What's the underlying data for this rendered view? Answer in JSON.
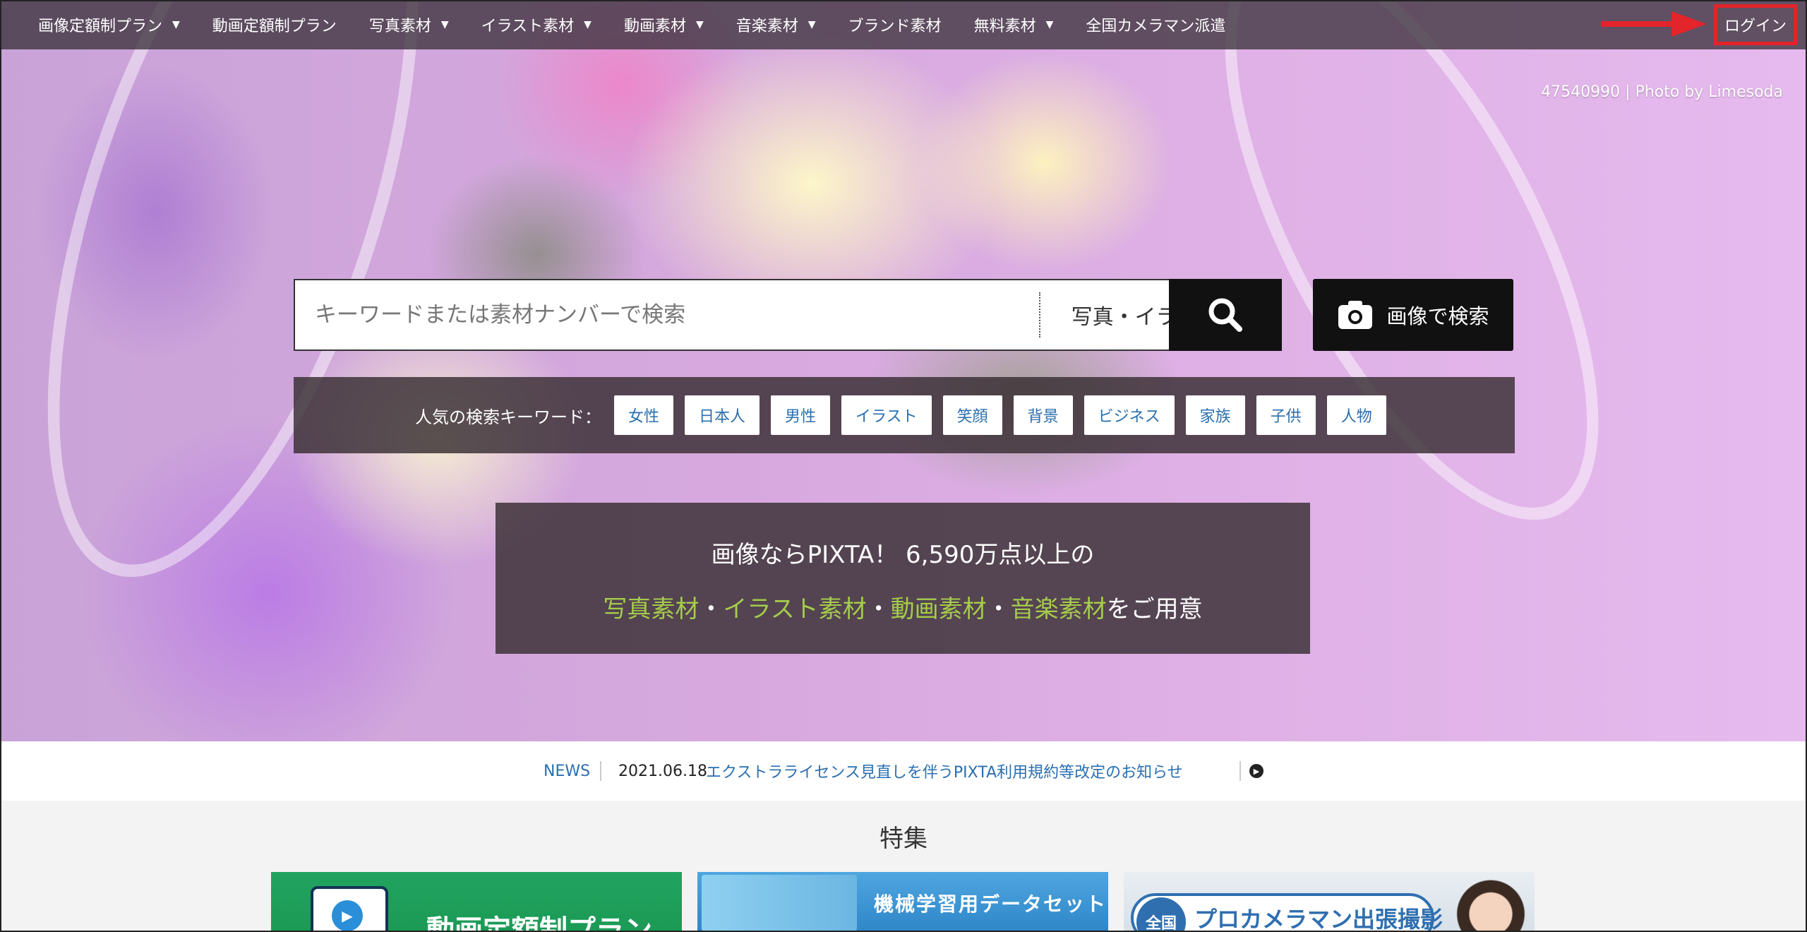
{
  "nav": {
    "items": [
      {
        "label": "画像定額制プラン",
        "has_dropdown": true
      },
      {
        "label": "動画定額制プラン",
        "has_dropdown": false
      },
      {
        "label": "写真素材",
        "has_dropdown": true
      },
      {
        "label": "イラスト素材",
        "has_dropdown": true
      },
      {
        "label": "動画素材",
        "has_dropdown": true
      },
      {
        "label": "音楽素材",
        "has_dropdown": true
      },
      {
        "label": "ブランド素材",
        "has_dropdown": false
      },
      {
        "label": "無料素材",
        "has_dropdown": true
      },
      {
        "label": "全国カメラマン派遣",
        "has_dropdown": false
      }
    ],
    "login_label": "ログイン",
    "caret": "▼"
  },
  "hero": {
    "credit": "47540990 | Photo by Limesoda"
  },
  "search": {
    "placeholder": "キーワードまたは素材ナンバーで検索",
    "type_selected": "写真・イラスト",
    "image_search_label": "画像で検索"
  },
  "keywords": {
    "label": "人気の検索キーワード：",
    "items": [
      "女性",
      "日本人",
      "男性",
      "イラスト",
      "笑顔",
      "背景",
      "ビジネス",
      "家族",
      "子供",
      "人物"
    ]
  },
  "promo": {
    "line1": "画像ならPIXTA！ 6,590万点以上の",
    "photo": "写真素材",
    "dot": "・",
    "illust": "イラスト素材",
    "video": "動画素材",
    "music": "音楽素材",
    "suffix": "をご用意"
  },
  "news": {
    "tag": "NEWS",
    "date": "2021.06.18",
    "text": "エクストラライセンス見直しを伴うPIXTA利用規約等改定のお知らせ"
  },
  "features": {
    "title": "特集",
    "cards": [
      {
        "text": "動画定額制プラン"
      },
      {
        "text": "機械学習用データセット"
      },
      {
        "badge": "全国",
        "text": "プロカメラマン出張撮影"
      }
    ]
  },
  "colors": {
    "accent_green": "#a4cc4a",
    "link_blue": "#2a6fb0",
    "highlight_red": "#e3242b"
  }
}
